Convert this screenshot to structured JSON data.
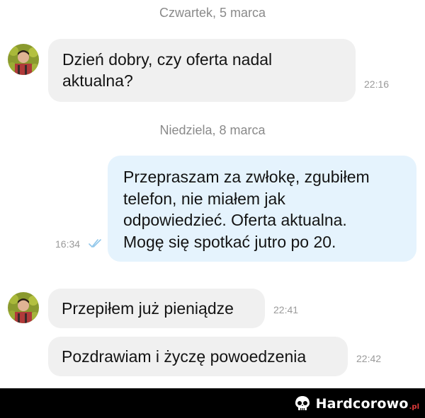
{
  "chat": {
    "separators": [
      "Czwartek, 5 marca",
      "Niedziela, 8 marca"
    ],
    "messages": [
      {
        "text_lines": [
          "Dzień dobry, czy oferta nadal",
          "aktualna?"
        ],
        "time": "22:16"
      },
      {
        "text_lines": [
          "Przepraszam za zwłokę, zgubiłem",
          "telefon, nie miałem jak",
          "odpowiedzieć. Oferta aktualna.",
          "Mogę się spotkać jutro po 20."
        ],
        "time": "16:34"
      },
      {
        "text": "Przepiłem już pieniądze",
        "time": "22:41"
      },
      {
        "text": "Pozdrawiam i życzę powoedzenia",
        "time": "22:42"
      }
    ]
  },
  "icons": {
    "avatar": "avatar-icon",
    "read_receipt": "double-check-icon",
    "logo": "skull-logo-icon"
  },
  "colors": {
    "incoming_bubble": "#f0f0f0",
    "outgoing_bubble": "#e5f3fd",
    "check": "#8fc6ea",
    "footer_bg": "#000000",
    "logo_accent": "#e23b3b"
  },
  "footer": {
    "brand": "Hardcorowo",
    "tld": ".pl"
  }
}
